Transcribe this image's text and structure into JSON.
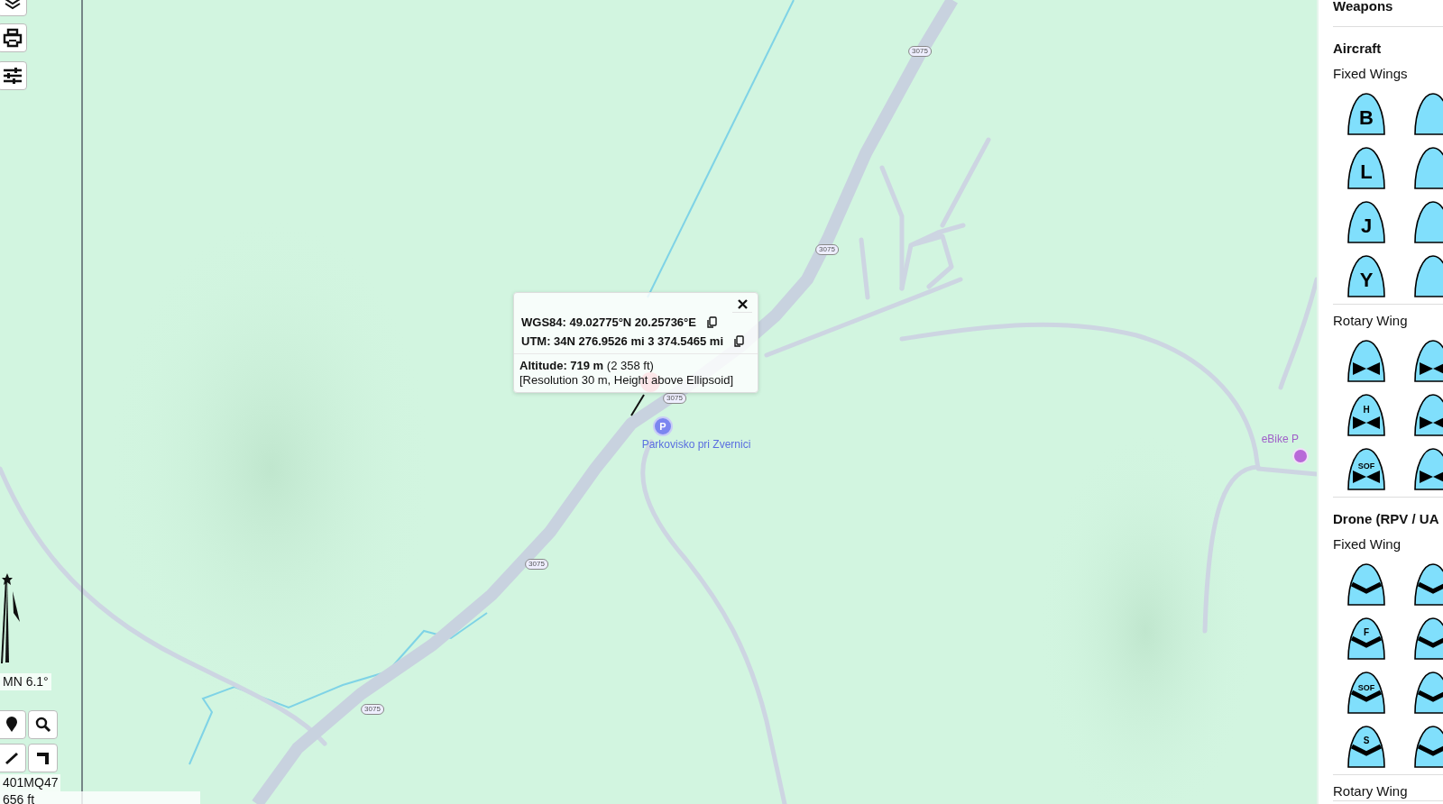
{
  "map": {
    "road_shields": [
      "3075",
      "3075",
      "3075",
      "3075",
      "3075"
    ],
    "places": [
      {
        "kind": "parking",
        "icon": "P",
        "name": "Parkovisko pri Zvernici"
      },
      {
        "kind": "bike",
        "name": "eBike P"
      }
    ],
    "declination": "MN 6.1°",
    "grid_reference": "401MQ47",
    "scale": "656 ft"
  },
  "popup": {
    "coordinates": [
      "WGS84: 49.02775°N 20.25736°E",
      "UTM: 34N 276.9526 mi 3 374.5465 mi"
    ],
    "altitude": "**Altitude: 719 m** (2 358 ft)",
    "note": "[Resolution 30 m, Height above Ellipsoid]"
  },
  "sidebar": {
    "sections": [
      {
        "title": "Weapons"
      },
      {
        "title": "Aircraft",
        "groups": [
          {
            "title": "Fixed Wings",
            "symbols": [
              {
                "kind": "letter",
                "label": "B"
              },
              {
                "kind": "letter"
              },
              {
                "kind": "letter",
                "label": "L"
              },
              {
                "kind": "letter"
              },
              {
                "kind": "letter",
                "label": "J"
              },
              {
                "kind": "letter"
              },
              {
                "kind": "letter",
                "label": "Y"
              },
              {
                "kind": "letter"
              }
            ]
          },
          {
            "title": "Rotary Wing",
            "symbols": [
              {
                "kind": "rotor"
              },
              {
                "kind": "rotor"
              },
              {
                "kind": "rotor",
                "label": "H"
              },
              {
                "kind": "rotor"
              },
              {
                "kind": "rotor",
                "label": "SOF"
              },
              {
                "kind": "rotor"
              }
            ]
          }
        ]
      },
      {
        "title": "Drone (RPV / UA",
        "groups": [
          {
            "title": "Fixed Wing",
            "symbols": [
              {
                "kind": "drone"
              },
              {
                "kind": "drone"
              },
              {
                "kind": "drone",
                "label": "F"
              },
              {
                "kind": "drone"
              },
              {
                "kind": "drone",
                "label": "SOF"
              },
              {
                "kind": "drone"
              },
              {
                "kind": "drone",
                "label": "S"
              },
              {
                "kind": "drone"
              }
            ]
          },
          {
            "title": "Rotary Wing"
          }
        ]
      }
    ]
  }
}
